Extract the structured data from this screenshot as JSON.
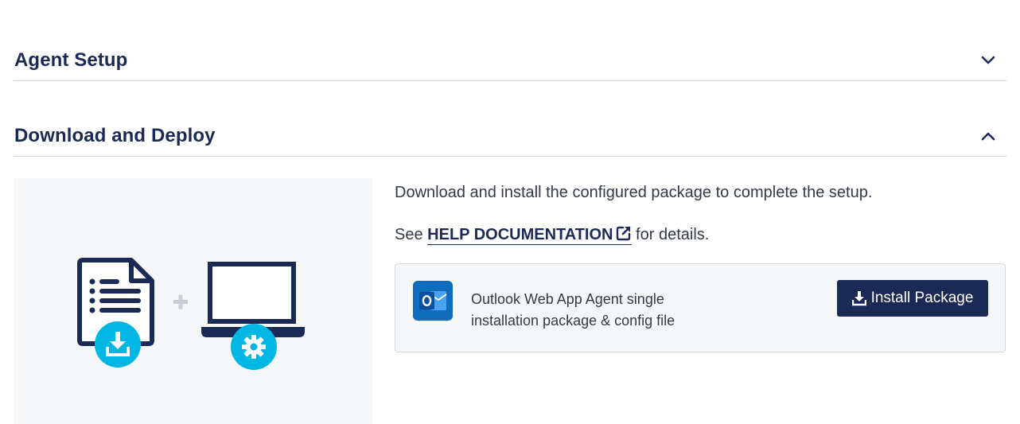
{
  "sections": {
    "agent_setup": {
      "title": "Agent Setup",
      "state": "collapsed",
      "chevron_icon": "chevron-down-icon"
    },
    "download_deploy": {
      "title": "Download and Deploy",
      "state": "expanded",
      "chevron_icon": "chevron-up-icon"
    }
  },
  "illustration": {
    "icons": [
      "document-icon",
      "download-icon",
      "plus-icon",
      "laptop-icon",
      "gear-icon"
    ],
    "colors": {
      "navy": "#1b2a55",
      "cyan": "#00b7e3",
      "plus": "#c9ced6",
      "background": "#f6f7f9"
    }
  },
  "content": {
    "intro_text": "Download and install the configured package to complete the setup.",
    "see_prefix": "See ",
    "help_link_label": "HELP DOCUMENTATION",
    "see_suffix": " for details.",
    "external_link_icon": "external-link-icon"
  },
  "package": {
    "icon": "outlook-icon",
    "description": "Outlook Web App Agent single installation package & config file",
    "install_button_label": "Install Package",
    "install_button_icon": "download-tray-icon"
  },
  "colors": {
    "heading": "#1b2a55",
    "button_bg": "#1b2a55",
    "button_text": "#ffffff",
    "divider": "#d4d7dc",
    "outlook_blue": "#0f6cbd"
  }
}
